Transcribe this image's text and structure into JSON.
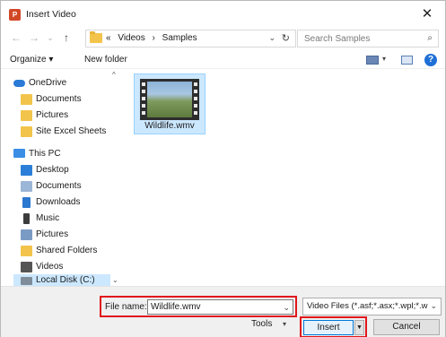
{
  "window": {
    "title": "Insert Video",
    "app_icon_letter": "P",
    "close_glyph": "✕"
  },
  "nav": {
    "back_glyph": "←",
    "forward_glyph": "→",
    "recent_glyph": "⌄",
    "up_glyph": "↑",
    "breadcrumb_prefix": "«",
    "breadcrumb": [
      "Videos",
      "›",
      "Samples"
    ],
    "address_dropdown_glyph": "⌄",
    "refresh_glyph": "↻",
    "search_placeholder": "Search Samples",
    "search_glyph": "⌕"
  },
  "toolbar": {
    "organize_label": "Organize ▾",
    "new_folder_label": "New folder",
    "view_dropdown_glyph": "▾",
    "help_glyph": "?"
  },
  "sidebar": {
    "scroll_up_glyph": "^",
    "scroll_down_glyph": "⌄",
    "items": [
      {
        "label": "OneDrive",
        "icon": "onedrive-icon",
        "color": "#2a7ad6"
      },
      {
        "label": "Documents",
        "icon": "folder-icon",
        "color": "#f3c44c"
      },
      {
        "label": "Pictures",
        "icon": "folder-icon",
        "color": "#f3c44c"
      },
      {
        "label": "Site Excel Sheets",
        "icon": "folder-icon",
        "color": "#f3c44c"
      },
      {
        "label": "This PC",
        "icon": "computer-icon",
        "color": "#3a8ee6"
      },
      {
        "label": "Desktop",
        "icon": "desktop-icon",
        "color": "#2b7fd8"
      },
      {
        "label": "Documents",
        "icon": "documents-icon",
        "color": "#9bb6d6"
      },
      {
        "label": "Downloads",
        "icon": "downloads-icon",
        "color": "#2b78d0"
      },
      {
        "label": "Music",
        "icon": "music-icon",
        "color": "#3c3c3c"
      },
      {
        "label": "Pictures",
        "icon": "pictures-icon",
        "color": "#7a9cc4"
      },
      {
        "label": "Shared Folders",
        "icon": "folder-icon",
        "color": "#f3c44c"
      },
      {
        "label": "Videos",
        "icon": "videos-icon",
        "color": "#555555"
      },
      {
        "label": "Local Disk (C:)",
        "icon": "disk-icon",
        "color": "#7f8c99"
      }
    ]
  },
  "content": {
    "files": [
      {
        "name": "Wildlife.wmv",
        "selected": true
      }
    ]
  },
  "bottom": {
    "file_name_label": "File name:",
    "file_name_value": "Wildlife.wmv",
    "file_name_dropdown_glyph": "⌄",
    "file_type_value": "Video Files (*.asf;*.asx;*.wpl;*.w",
    "file_type_dropdown_glyph": "⌄",
    "tools_label": "Tools",
    "tools_dropdown_glyph": "▾",
    "insert_label": "Insert",
    "insert_split_glyph": "▼",
    "cancel_label": "Cancel"
  },
  "colors": {
    "highlight_red": "#e0171b",
    "selection_blue": "#cce8ff",
    "accent_blue": "#0078d7"
  }
}
